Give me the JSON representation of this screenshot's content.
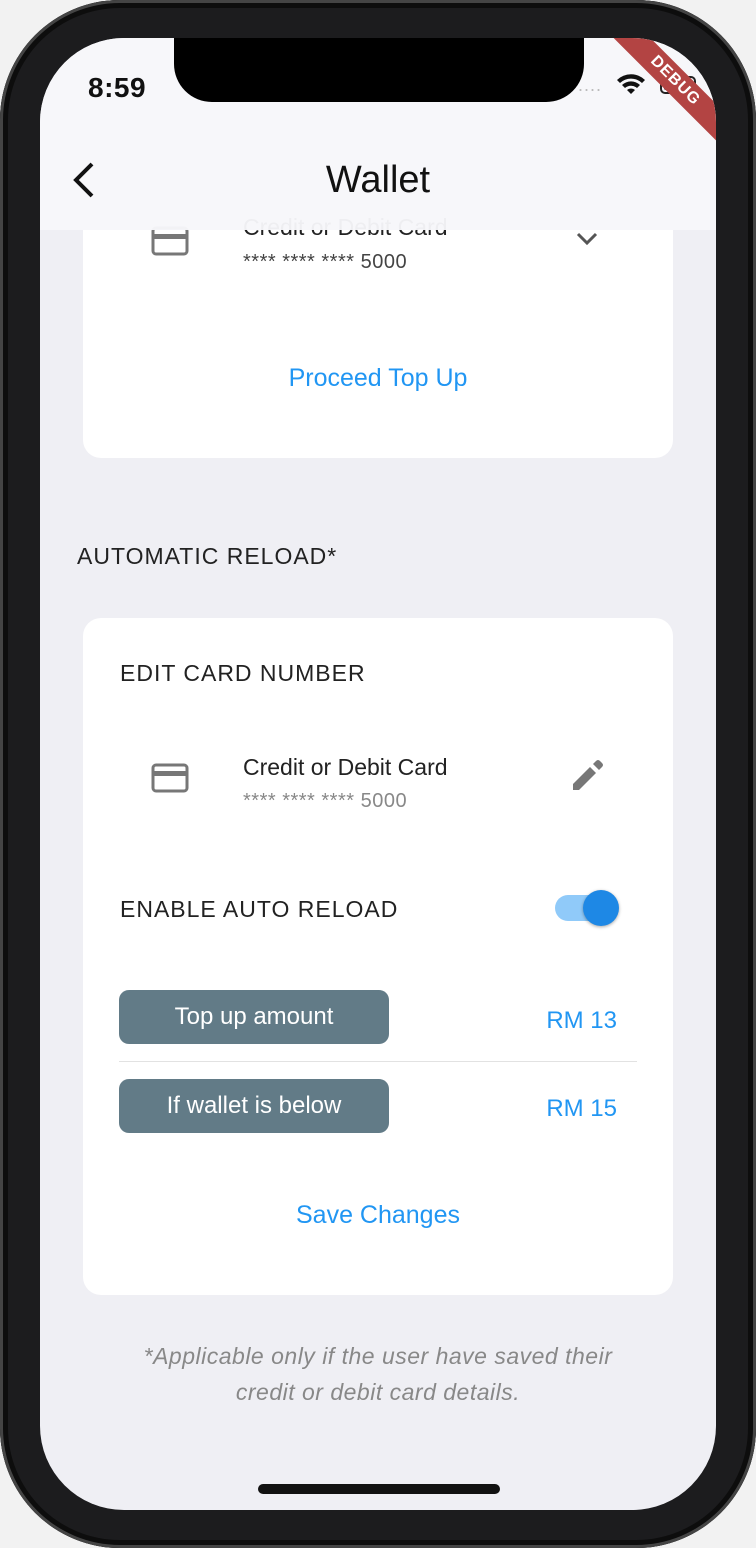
{
  "status_bar": {
    "time": "8:59",
    "signal": "....",
    "debug_banner": "DEBUG"
  },
  "app_bar": {
    "title": "Wallet",
    "back_icon": "chevron-left-icon"
  },
  "top_card": {
    "payment_title": "Credit or Debit Card",
    "card_number": "**** **** **** 5000",
    "card_icon": "credit-card-icon",
    "dropdown_icon": "chevron-down-icon",
    "action_label": "Proceed Top Up"
  },
  "automatic_reload": {
    "section_title": "AUTOMATIC RELOAD*",
    "edit_card_label": "EDIT CARD NUMBER",
    "payment_title": "Credit or Debit Card",
    "card_number": "**** **** **** 5000",
    "card_icon": "credit-card-icon",
    "edit_icon": "pencil-icon",
    "enable_label": "ENABLE AUTO RELOAD",
    "enabled": true,
    "top_up_label": "Top up amount",
    "top_up_value": "RM 13",
    "threshold_label": "If wallet is below",
    "threshold_value": "RM 15",
    "save_label": "Save Changes"
  },
  "footnote": {
    "line1": "*Applicable only if the user have saved their",
    "line2": "credit or debit card details."
  },
  "colors": {
    "accent": "#2196f3",
    "pill_background": "#627b87",
    "screen_background": "#efeff4",
    "debug_ribbon": "#b34443"
  }
}
